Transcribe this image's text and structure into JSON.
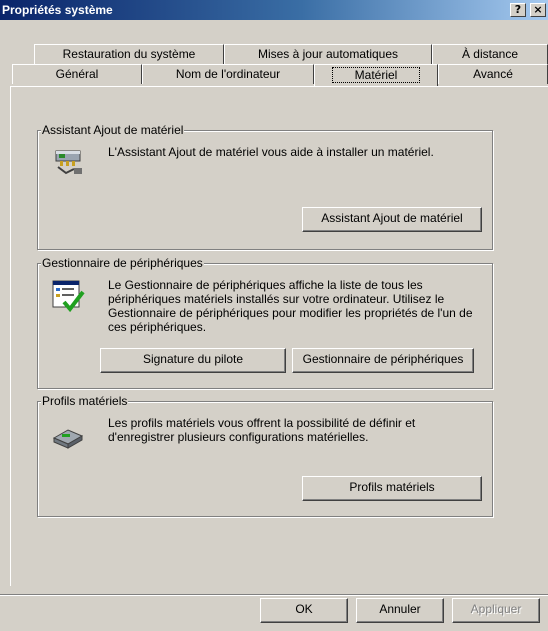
{
  "window": {
    "title": "Propriétés système",
    "help_btn": "?",
    "close_btn": "×"
  },
  "tabs_row1": [
    "Restauration du système",
    "Mises à jour automatiques",
    "À distance"
  ],
  "tabs_row2": [
    "Général",
    "Nom de l'ordinateur",
    "Matériel",
    "Avancé"
  ],
  "selected_tab": "Matériel",
  "groups": {
    "wizard": {
      "label": "Assistant Ajout de matériel",
      "text": "L'Assistant Ajout de matériel vous aide à installer un matériel.",
      "button": "Assistant Ajout de matériel",
      "icon": "hardware-wizard-icon"
    },
    "devmgr": {
      "label": "Gestionnaire de périphériques",
      "text": "Le Gestionnaire de périphériques affiche la liste de tous les périphériques matériels installés sur votre ordinateur. Utilisez le Gestionnaire de périphériques pour modifier les propriétés de l'un de ces périphériques.",
      "button_signature": "Signature du pilote",
      "button_manager": "Gestionnaire de périphériques",
      "icon": "device-manager-icon"
    },
    "profiles": {
      "label": "Profils matériels",
      "text": "Les profils matériels vous offrent la possibilité de définir et d'enregistrer plusieurs configurations matérielles.",
      "button": "Profils matériels",
      "icon": "hardware-profiles-icon"
    }
  },
  "footer": {
    "ok": "OK",
    "cancel": "Annuler",
    "apply": "Appliquer"
  }
}
